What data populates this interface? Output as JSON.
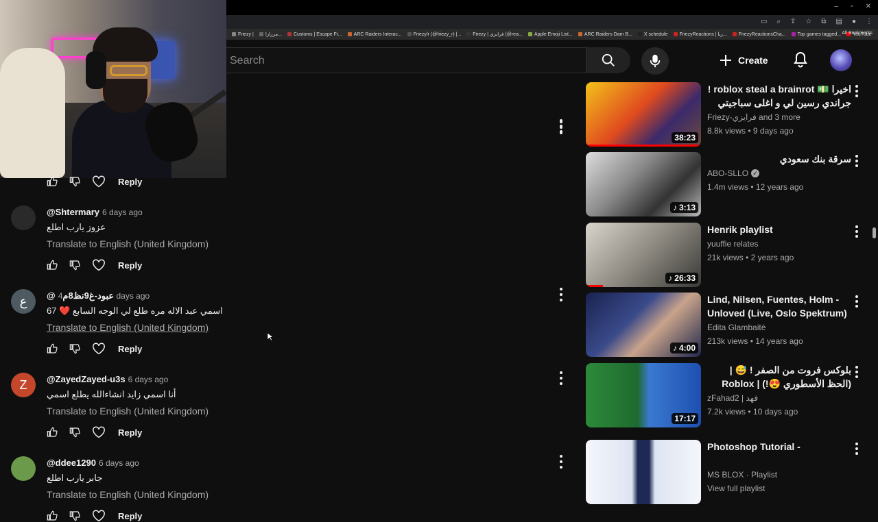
{
  "browser": {
    "bookmarks": [
      "Friezy |",
      "مرزارا...",
      "Customs | Escape Fr...",
      "ARC Raiders Interac...",
      "Friezy/r (@friezy_r) |...",
      "Friezy | فرايزي (@rea...",
      "Apple Emoji List...",
      "ARC Raiders Dam B...",
      "X schedule",
      "FriezyReactions | ريا...",
      "FriezyReactionsCha...",
      "Top games tagged...",
      "YouTube"
    ],
    "all_bookmarks": "All Bookmarks"
  },
  "header": {
    "search_placeholder": "Search",
    "create_label": "Create"
  },
  "comments": [
    {
      "author": "@Shtermary",
      "time": "6 days ago",
      "text": "عزوز يارب اطلع",
      "translate": "Translate to English (United Kingdom)",
      "avatar_letter": "",
      "avatar_color": "#2a2a2a",
      "translate_underline": false
    },
    {
      "author": "@عبود-غ9نظ8م",
      "time": "4 days ago",
      "text": "اسمي عبد الاله مره طلع لي الوجه السابع ❤️ 67",
      "translate": "Translate to English (United Kingdom)",
      "avatar_letter": "ع",
      "avatar_color": "#4d5a62",
      "translate_underline": true
    },
    {
      "author": "@ZayedZayed-u3s",
      "time": "6 days ago",
      "text": "أنا اسمي زايد انشاءالله يطلع اسمي",
      "translate": "Translate to English (United Kingdom)",
      "avatar_letter": "Z",
      "avatar_color": "#c4472c",
      "translate_underline": false
    },
    {
      "author": "@ddee1290",
      "time": "6 days ago",
      "text": "جابر يارب اطلع",
      "translate": "Translate to English (United Kingdom)",
      "avatar_letter": "",
      "avatar_color": "#6a9a4a",
      "translate_underline": false
    }
  ],
  "reply_label": "Reply",
  "related": [
    {
      "title": "اخيرا 💵 roblox steal a brainrot ! جراندي رسين لي و اغلى سباجيتي توايليتي...",
      "channel": "Friezy-فرايزي and 3 more",
      "verified": false,
      "views": "8.8k views",
      "age": "9 days ago",
      "duration": "38:23",
      "music": false,
      "progress": 1.0
    },
    {
      "title": "سرقة بنك سعودي",
      "channel": "ABO-SLLO",
      "verified": true,
      "views": "1.4m views",
      "age": "12 years ago",
      "duration": "3:13",
      "music": true,
      "progress": 0
    },
    {
      "title": "Henrik playlist",
      "channel": "yuuffie relates",
      "verified": false,
      "views": "21k views",
      "age": "2 years ago",
      "duration": "26:33",
      "music": true,
      "progress": 0.15
    },
    {
      "title": "Lind, Nilsen, Fuentes, Holm - Unloved (Live, Oslo Spektrum) ...",
      "channel": "Edita Glambaitė",
      "verified": false,
      "views": "213k views",
      "age": "14 years ago",
      "duration": "4:00",
      "music": true,
      "progress": 0
    },
    {
      "title": "بلوكس فروت من الصفر ! 😅 | (الحظ الأسطوري 😍!) | Roblox blox Fruit",
      "channel": "zFahad2 | فهد",
      "verified": false,
      "views": "7.2k views",
      "age": "10 days ago",
      "duration": "17:17",
      "music": false,
      "progress": 0
    },
    {
      "title": "Photoshop Tutorial -",
      "channel": "MS BLOX · Playlist",
      "verified": false,
      "views": "View full playlist",
      "age": "",
      "duration": "",
      "music": false,
      "progress": 0
    }
  ],
  "colors": {
    "accent": "#ff0000",
    "background": "#0f0f0f",
    "secondary_text": "#aaaaaa"
  }
}
